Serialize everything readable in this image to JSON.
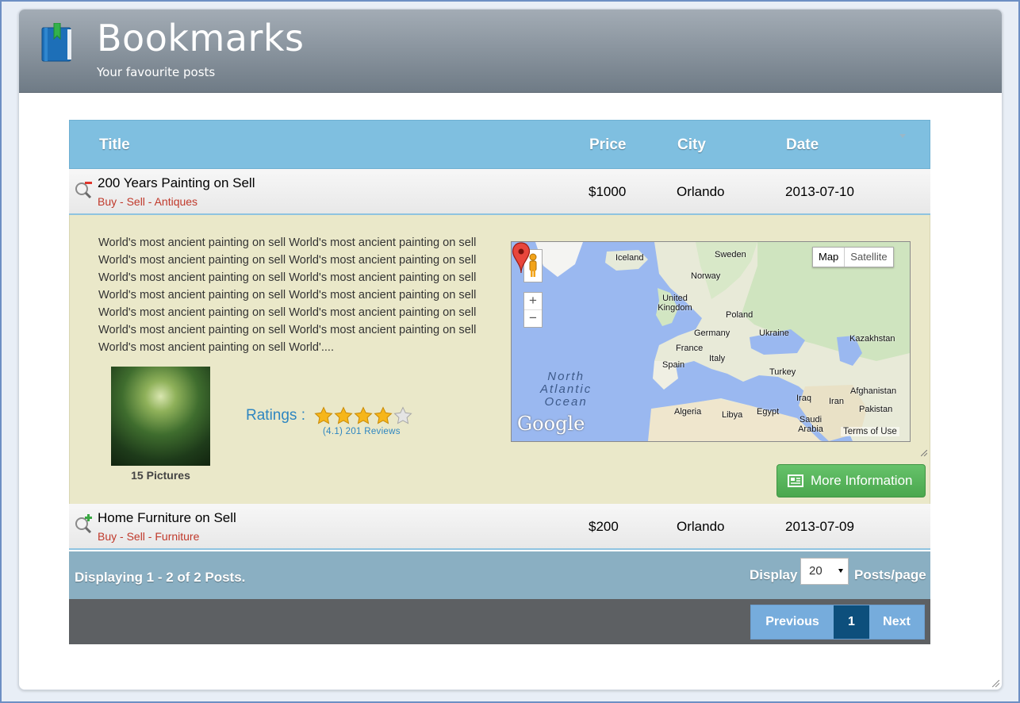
{
  "header": {
    "title": "Bookmarks",
    "subtitle": "Your favourite posts"
  },
  "table": {
    "columns": [
      "Title",
      "Price",
      "City",
      "Date"
    ],
    "rows": [
      {
        "title": "200 Years Painting on Sell",
        "categories": "Buy - Sell - Antiques",
        "price": "$1000",
        "city": "Orlando",
        "date": "2013-07-10",
        "icon": "magnifier-minus-icon",
        "expanded": true
      },
      {
        "title": "Home Furniture on Sell",
        "categories": "Buy - Sell - Furniture",
        "price": "$200",
        "city": "Orlando",
        "date": "2013-07-09",
        "icon": "magnifier-plus-icon",
        "expanded": false
      }
    ]
  },
  "detail": {
    "description": "World's most ancient painting on sell World's most ancient painting on sell World's most ancient painting on sell World's most ancient painting on sell World's most ancient painting on sell World's most ancient painting on sell World's most ancient painting on sell World's most ancient painting on sell World's most ancient painting on sell World's most ancient painting on sell World's most ancient painting on sell World's most ancient painting on sell World's most ancient painting on sell World'....",
    "pictures_caption": "15 Pictures",
    "ratings_label": "Ratings :",
    "rating_value": 4.1,
    "rating_max": 5,
    "reviews_text": "(4.1) 201 Reviews",
    "more_button": "More Information",
    "map": {
      "type_map": "Map",
      "type_satellite": "Satellite",
      "zoom_in": "+",
      "zoom_out": "−",
      "brand": "Google",
      "terms": "Terms of Use",
      "ocean": "North\nAtlantic\nOcean",
      "labels": [
        "Iceland",
        "Sweden",
        "Norway",
        "United Kingdom",
        "Poland",
        "Germany",
        "Ukraine",
        "Kazakhstan",
        "France",
        "Italy",
        "Spain",
        "Turkey",
        "Iraq",
        "Iran",
        "Afghanistan",
        "Pakistan",
        "Algeria",
        "Libya",
        "Egypt",
        "Saudi Arabia"
      ]
    }
  },
  "footer": {
    "summary": "Displaying 1 - 2 of 2 Posts.",
    "display_label": "Display",
    "page_size": "20",
    "posts_label": "Posts/page"
  },
  "pager": {
    "previous": "Previous",
    "current": "1",
    "next": "Next"
  },
  "colors": {
    "header_blue": "#7fbfe0",
    "category_red": "#c0392b",
    "detail_bg": "#eae8c9",
    "green_button": "#4aa74e",
    "pager_active": "#0d4f7c"
  }
}
